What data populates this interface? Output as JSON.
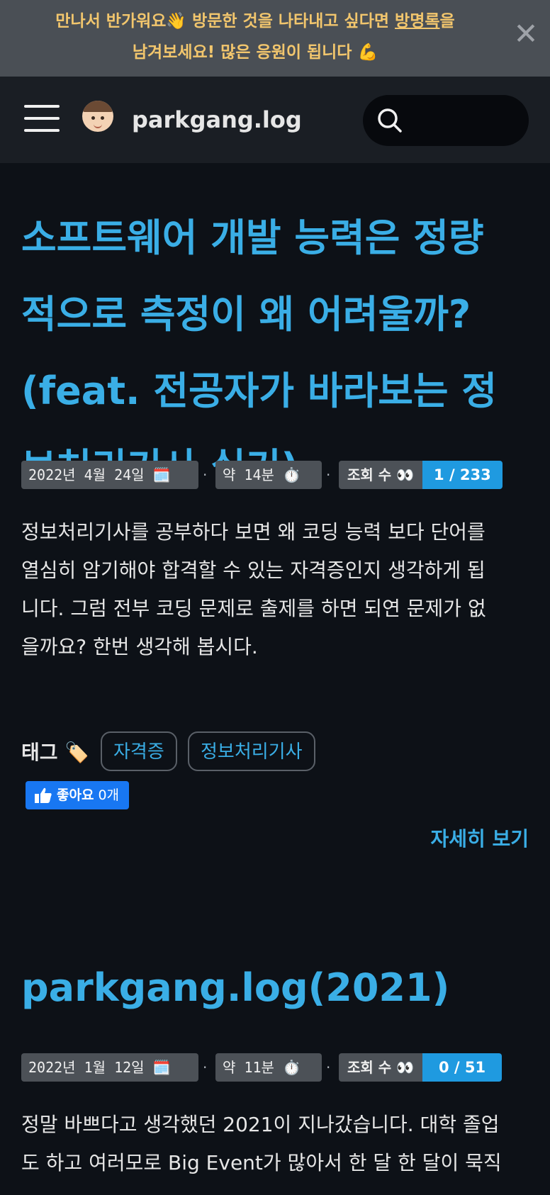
{
  "banner": {
    "text_before": "만나서 반가워요👋 방문한 것을 나타내고 싶다면 ",
    "link_text": "방명록",
    "text_after": "을",
    "line2": "남겨보세요! 많은 응원이 됩니다 💪",
    "close_icon": "close-icon"
  },
  "header": {
    "menu_icon": "hamburger-icon",
    "site_name": "parkgang.log",
    "search_placeholder": ""
  },
  "posts": [
    {
      "title_lines": [
        "소프트웨어 개발 능력은 정량",
        "적으로 측정이 왜 어려울까?",
        "(feat. 전공자가 바라보는 정",
        "보처리기사 실기)"
      ],
      "date": "2022년 4월 24일 🗓️",
      "read_time": "약 14분 ⏱️",
      "views_label": "조회 수 👀",
      "views_count": "1 / 233",
      "excerpt_lines": [
        "정보처리기사를 공부하다 보면 왜 코딩 능력 보다 단어를",
        "열심히 암기해야 합격할 수 있는 자격증인지 생각하게 됩",
        "니다. 그럼 전부 코딩 문제로 출제를 하면 되연 문제가 없",
        "을까요? 한번 생각해 봅시다."
      ],
      "tags_label": "태그 🏷️",
      "tags": [
        "자격증",
        "정보처리기사"
      ],
      "like_label": "좋아요",
      "like_count": "0개",
      "more_label": "자세히 보기"
    },
    {
      "title_lines": [
        "parkgang.log(2021)"
      ],
      "date": "2022년 1월 12일 🗓️",
      "read_time": "약 11분 ⏱️",
      "views_label": "조회 수 👀",
      "views_count": "0 / 51",
      "excerpt_lines": [
        "정말 바쁘다고 생각했던 2021이 지나갔습니다. 대학 졸업",
        "도 하고 여러모로 Big Event가 많아서 한 달 한 달이 묵직"
      ]
    }
  ],
  "colors": {
    "background": "#0d1117",
    "accent": "#3aaee6",
    "banner_bg": "#4a4f55",
    "banner_text": "#f2c66d",
    "views_count_bg": "#1f9ae0",
    "like_bg": "#1877f2"
  }
}
